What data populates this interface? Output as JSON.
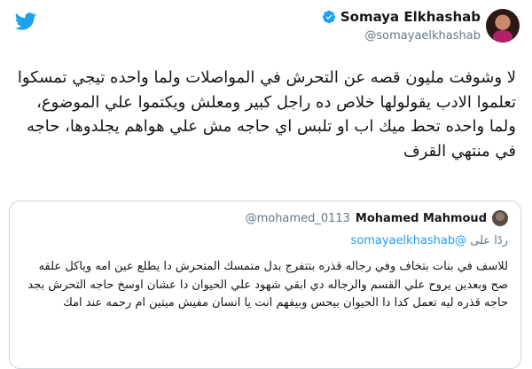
{
  "author": {
    "name": "Somaya Elkhashab",
    "handle": "@somayaelkhashab"
  },
  "tweet": {
    "text": "لا وشوفت مليون قصه عن التحرش في المواصلات ولما واحده تيجي تمسكوا تعلموا الادب يقولولها خلاص ده راجل كبير ومعلش ويكتموا علي الموضوع، ولما واحده تحط ميك اب او تلبس اي حاجه مش علي هواهم يجلدوها، حاجه في منتهي القرف"
  },
  "quoted": {
    "name": "Mohamed Mahmoud",
    "handle": "@mohamed_0113",
    "reply_prefix": "ردًا على",
    "reply_to": "@somayaelkhashab",
    "text": "للاسف في بنات بتخاف وفي رجاله قذره بتتفرج بدل متمسك المتحرش دا يطلع عين امه وياكل علقه صح وبعدين يروح علي القسم والرجاله دي ابقي شهود علي الحيوان دا عشان اوسخ حاجه التحرش بجد حاجه قذره ليه تعمل كدا دا الحيوان بيحس وبيفهم انت يا انسان مفيش ميتين ام رحمه عند امك"
  },
  "icons": {
    "logo": "twitter-bird-icon",
    "verified": "verified-badge-icon"
  },
  "colors": {
    "brand": "#1da1f2",
    "text": "#14171a",
    "muted": "#657786"
  }
}
